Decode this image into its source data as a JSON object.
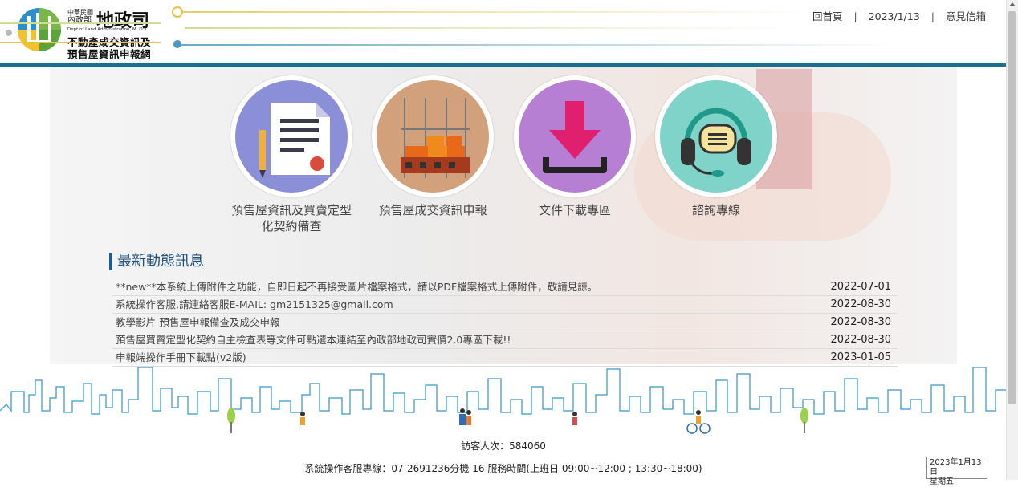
{
  "header": {
    "logo_small_1": "中華民國",
    "logo_small_2": "內政部",
    "logo_main": "地政司",
    "logo_english": "Dept of Land Administration, M. O. I.",
    "site_title_1": "不動產成交資訊及",
    "site_title_2": "預售屋資訊申報網",
    "links": {
      "home": "回首頁",
      "date": "2023/1/13",
      "mailbox": "意見信箱",
      "separator": "|"
    }
  },
  "features": [
    {
      "label": "預售屋資訊及買賣定型化契約備查",
      "icon": "contract-document-icon",
      "color": "#8a8fd8"
    },
    {
      "label": "預售屋成交資訊申報",
      "icon": "building-construction-icon",
      "color": "#d2a07a"
    },
    {
      "label": "文件下載專區",
      "icon": "download-icon",
      "color": "#b77fd4"
    },
    {
      "label": "諮詢專線",
      "icon": "headset-icon",
      "color": "#7fd3c9"
    }
  ],
  "news": {
    "title": "最新動態訊息",
    "items": [
      {
        "text": "**new**本系統上傳附件之功能，自即日起不再接受圖片檔案格式，請以PDF檔案格式上傳附件，敬請見諒。",
        "date": "2022-07-01"
      },
      {
        "text": "系統操作客服,請連絡客服E-MAIL: gm2151325@gmail.com",
        "date": "2022-08-30"
      },
      {
        "text": "教學影片-預售屋申報備查及成交申報",
        "date": "2022-08-30"
      },
      {
        "text": "預售屋買賣定型化契約自主檢查表等文件可點選本連結至內政部地政司實價2.0專區下載!!",
        "date": "2022-08-30"
      },
      {
        "text": "申報端操作手冊下載點(v2版)",
        "date": "2023-01-05"
      }
    ]
  },
  "footer": {
    "visitor": "訪客人次：584060",
    "hotline": "系統操作客服專線：07-2691236分機 16 服務時間(上班日 09:00~12:00 ; 13:30~18:00)"
  },
  "clock": {
    "date": "2023年1月13日",
    "weekday": "星期五"
  },
  "colors": {
    "accent": "#1a6e92",
    "news_title": "#1f4e79"
  }
}
